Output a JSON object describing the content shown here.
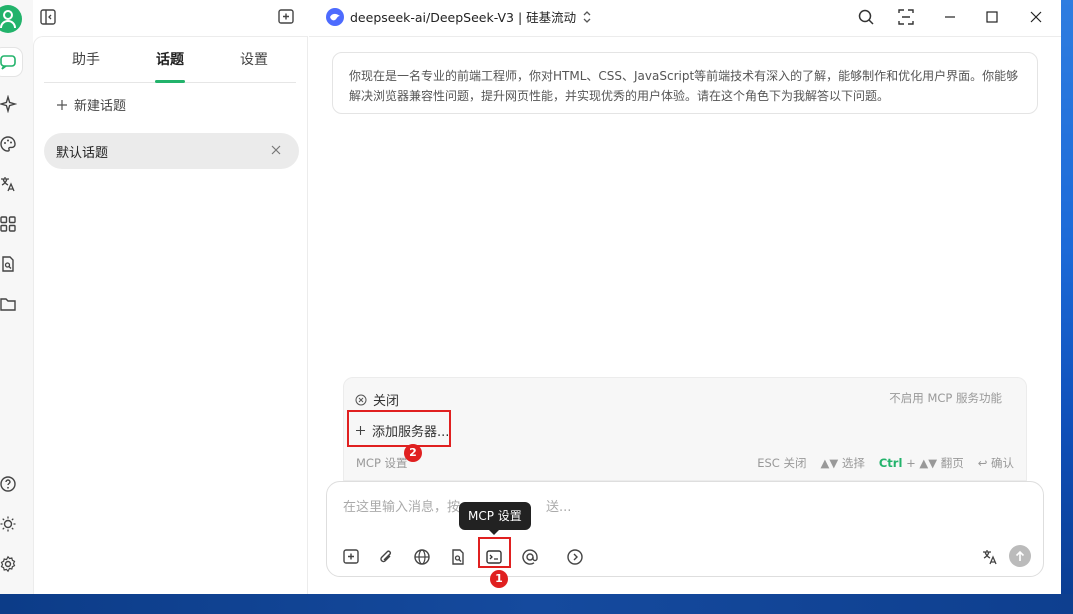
{
  "header": {
    "model_name": "deepseek-ai/DeepSeek-V3 | 硅基流动"
  },
  "sidebar": {
    "tabs": [
      "助手",
      "话题",
      "设置"
    ],
    "active_tab": "话题",
    "new_topic_label": "新建话题",
    "topics": [
      {
        "label": "默认话题"
      }
    ]
  },
  "main": {
    "system_prompt": "你现在是一名专业的前端工程师，你对HTML、CSS、JavaScript等前端技术有深入的了解，能够制作和优化用户界面。你能够解决浏览器兼容性问题，提升网页性能，并实现优秀的用户体验。请在这个角色下为我解答以下问题。"
  },
  "mcp_panel": {
    "close_label": "关闭",
    "close_hint": "不启用 MCP 服务功能",
    "add_server_label": "添加服务器...",
    "footer_title": "MCP 设置",
    "key_esc": "ESC 关闭",
    "key_select": "▲▼ 选择",
    "key_ctrl": "Ctrl",
    "key_page": "+ ▲▼ 翻页",
    "key_confirm": "↩ 确认"
  },
  "input": {
    "placeholder_visible": "在这里输入消息，按",
    "placeholder_tail": "送..."
  },
  "tooltip": {
    "text": "MCP 设置"
  },
  "annotations": {
    "badge1": "1",
    "badge2": "2",
    "color": "#e02020"
  },
  "colors": {
    "accent": "#22b36b",
    "model_logo": "#4d6bfe"
  }
}
